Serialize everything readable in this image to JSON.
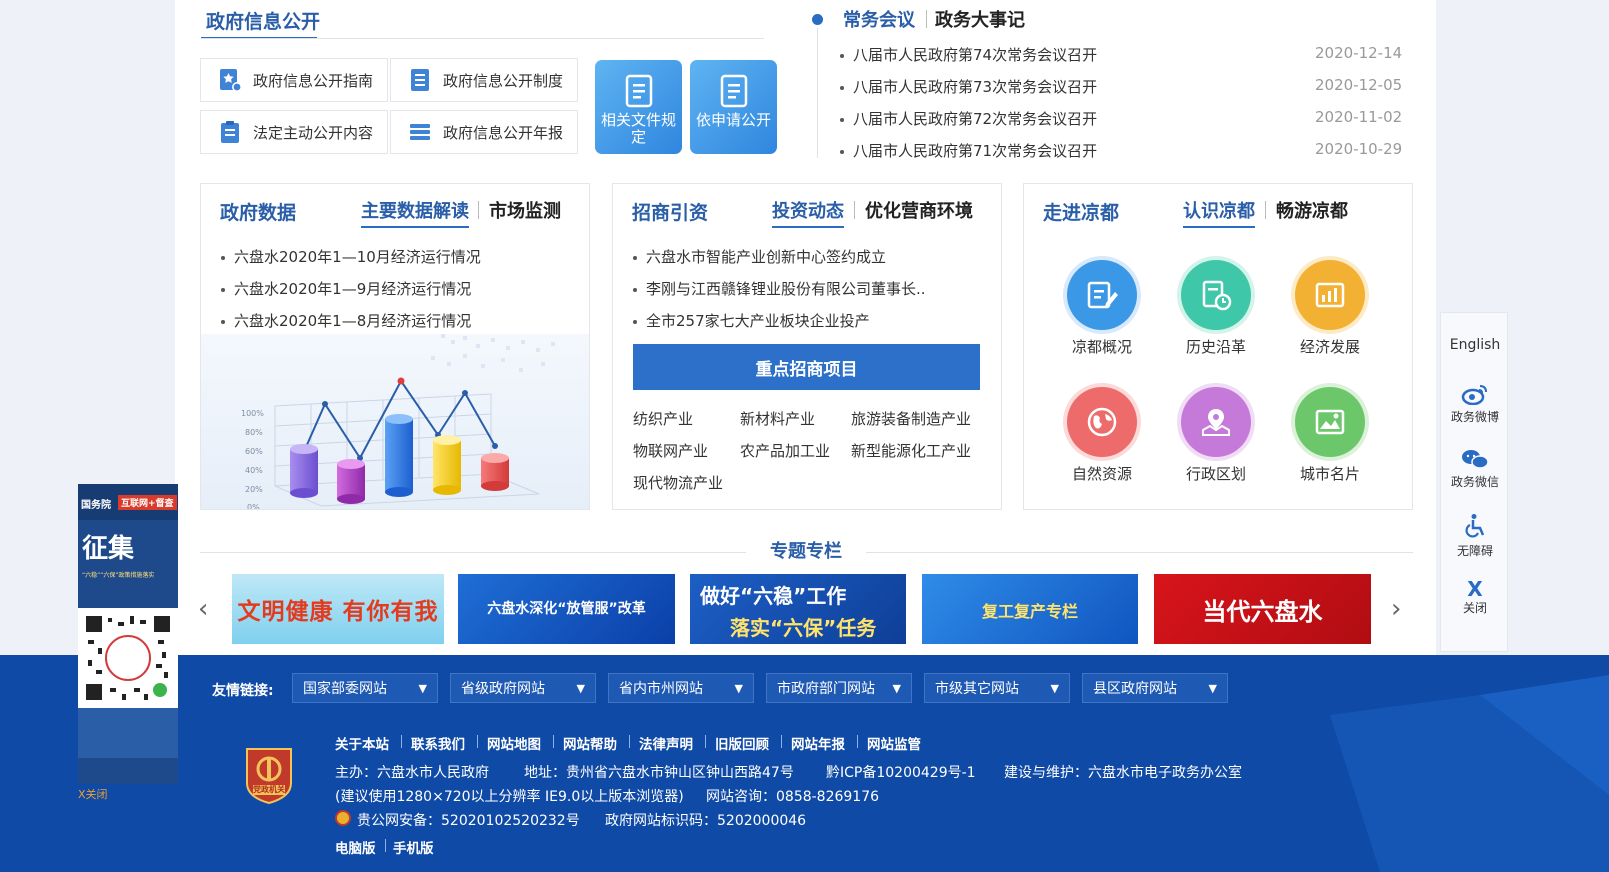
{
  "gov_info": {
    "title": "政府信息公开",
    "buttons": [
      {
        "label": "政府信息公开指南",
        "icon": "star-document-icon"
      },
      {
        "label": "政府信息公开制度",
        "icon": "list-document-icon"
      },
      {
        "label": "法定主动公开内容",
        "icon": "clipboard-list-icon"
      },
      {
        "label": "政府信息公开年报",
        "icon": "stack-layers-icon"
      }
    ],
    "big_buttons": [
      {
        "label": "相关文件规定",
        "icon": "file-document-icon"
      },
      {
        "label": "依申请公开",
        "icon": "file-document-icon"
      }
    ]
  },
  "meetings": {
    "tab_active": "常务会议",
    "tab_other": "政务大事记",
    "items": [
      {
        "title": "八届市人民政府第74次常务会议召开",
        "date": "2020-12-14"
      },
      {
        "title": "八届市人民政府第73次常务会议召开",
        "date": "2020-12-05"
      },
      {
        "title": "八届市人民政府第72次常务会议召开",
        "date": "2020-11-02"
      },
      {
        "title": "八届市人民政府第71次常务会议召开",
        "date": "2020-10-29"
      }
    ]
  },
  "gov_data": {
    "title": "政府数据",
    "tab_active": "主要数据解读",
    "tab_other": "市场监测",
    "items": [
      "六盘水2020年1—10月经济运行情况",
      "六盘水2020年1—9月经济运行情况",
      "六盘水2020年1—8月经济运行情况"
    ],
    "illustration_ticks": [
      "100%",
      "80%",
      "60%",
      "40%",
      "20%",
      "0%"
    ]
  },
  "investment": {
    "title": "招商引资",
    "tab_active": "投资动态",
    "tab_other": "优化营商环境",
    "items": [
      "六盘水市智能产业创新中心签约成立",
      "李刚与江西赣锋锂业股份有限公司董事长..",
      "全市257家七大产业板块企业投产"
    ],
    "key_projects_button": "重点招商项目",
    "industries": [
      "纺织产业",
      "新材料产业",
      "旅游装备制造产业",
      "物联网产业",
      "农产品加工业",
      "新型能源化工产业",
      "现代物流产业"
    ]
  },
  "liangdu": {
    "title": "走进凉都",
    "tab_active": "认识凉都",
    "tab_other": "畅游凉都",
    "icons": [
      {
        "label": "凉都概况",
        "icon": "edit-document-icon",
        "color": "#3b98e6"
      },
      {
        "label": "历史沿革",
        "icon": "history-clock-icon",
        "color": "#3ec7a8"
      },
      {
        "label": "经济发展",
        "icon": "bar-chart-icon",
        "color": "#f2b132"
      },
      {
        "label": "自然资源",
        "icon": "globe-icon",
        "color": "#ee6b6b"
      },
      {
        "label": "行政区划",
        "icon": "map-pin-icon",
        "color": "#c57ad9"
      },
      {
        "label": "城市名片",
        "icon": "image-icon",
        "color": "#6cc76a"
      }
    ]
  },
  "special": {
    "title": "专题专栏",
    "banners": [
      {
        "text": "文明健康 有你有我"
      },
      {
        "text": "六盘水深化“放管服”改革"
      },
      {
        "text_line1": "做好“六稳”工作",
        "text_line2": "落实“六保”任务"
      },
      {
        "text": "复工复产专栏"
      },
      {
        "text": "当代六盘水"
      }
    ]
  },
  "footer": {
    "links_label": "友情链接:",
    "selects": [
      "国家部委网站",
      "省级政府网站",
      "省内市州网站",
      "市政府部门网站",
      "市级其它网站",
      "县区政府网站"
    ],
    "nav_links": [
      "关于本站",
      "联系我们",
      "网站地图",
      "网站帮助",
      "法律声明",
      "旧版回顾",
      "网站年报",
      "网站监管"
    ],
    "host": "主办：六盘水市人民政府",
    "address": "地址：贵州省六盘水市钟山区钟山西路47号",
    "icp": "黔ICP备10200429号-1",
    "maintainer": "建设与维护：六盘水市电子政务办公室",
    "browser_tip": "(建议使用1280×720以上分辨率 IE9.0以上版本浏览器)",
    "hotline": "网站咨询：0858-8269176",
    "police": "贵公网安备：52020102520232号",
    "site_id": "政府网站标识码：5202000046",
    "pc_version": "电脑版",
    "mobile_version": "手机版",
    "badge_text": "党政机关"
  },
  "sidebar": {
    "english": "English",
    "weibo": "政务微博",
    "wechat": "政务微信",
    "accessibility": "无障碍",
    "close": "关闭",
    "close_mark": "X"
  },
  "left_ad": {
    "header_left": "国务院",
    "header_right": "互联网+督查",
    "title": "征集",
    "subtitle": "“六稳”“六保”政策措施落实",
    "close": "X关闭"
  }
}
